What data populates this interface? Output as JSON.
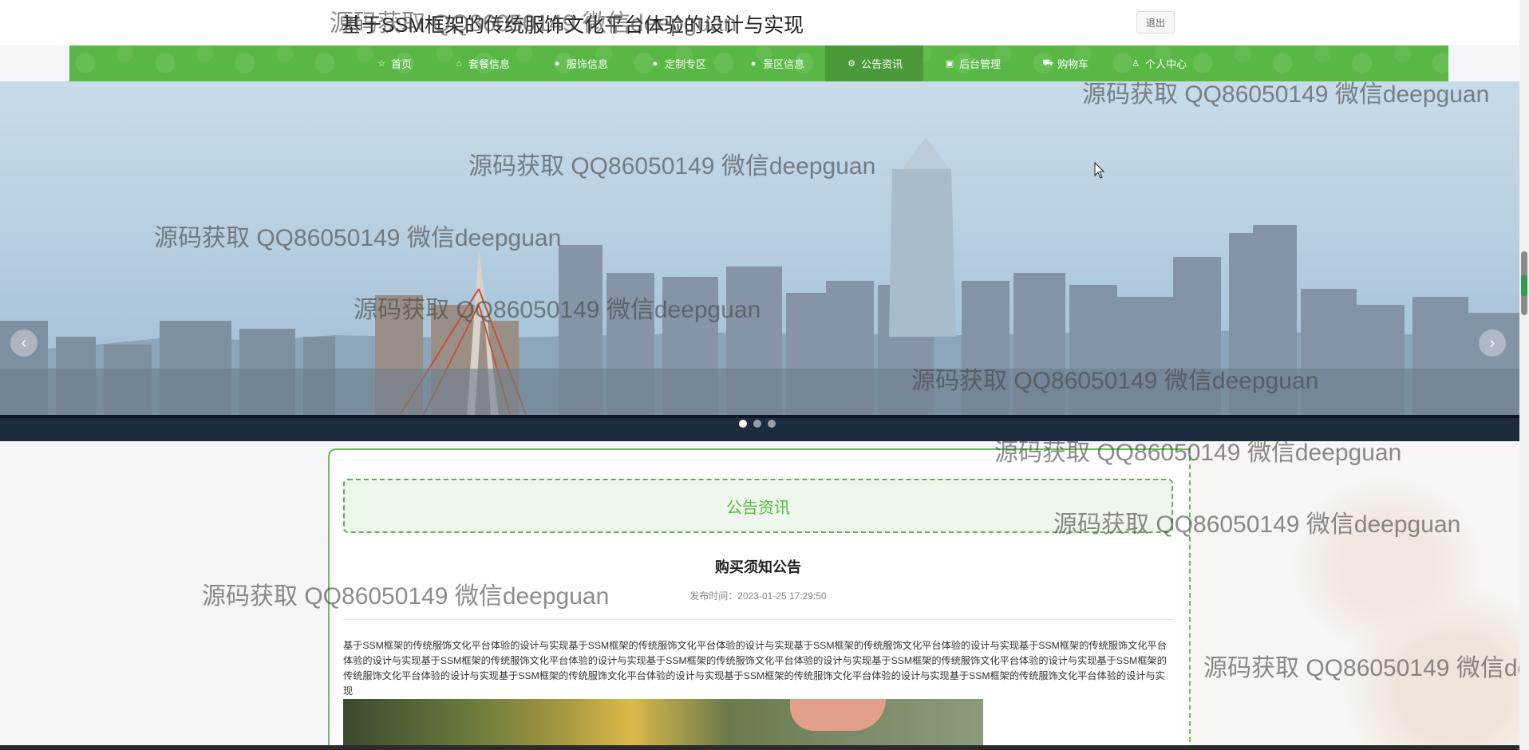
{
  "header": {
    "site_title": "基于SSM框架的传统服饰文化平台体验的设计与实现",
    "logout_label": "退出"
  },
  "nav": {
    "items": [
      {
        "label": "首页",
        "icon": "star-icon",
        "glyph": "☆"
      },
      {
        "label": "套餐信息",
        "icon": "bag-icon",
        "glyph": "⌂"
      },
      {
        "label": "服饰信息",
        "icon": "info-icon",
        "glyph": "●"
      },
      {
        "label": "定制专区",
        "icon": "help-icon",
        "glyph": "●"
      },
      {
        "label": "景区信息",
        "icon": "info-icon",
        "glyph": "●"
      },
      {
        "label": "公告资讯",
        "icon": "gear-icon",
        "glyph": "⚙"
      },
      {
        "label": "后台管理",
        "icon": "gift-icon",
        "glyph": "▣"
      },
      {
        "label": "购物车",
        "icon": "cart-icon",
        "glyph": "⛟"
      },
      {
        "label": "个人中心",
        "icon": "user-icon",
        "glyph": "♙"
      }
    ],
    "active_index": 5
  },
  "banner": {
    "prev_glyph": "‹",
    "next_glyph": "›",
    "slide_count": 3,
    "active_slide": 0
  },
  "section": {
    "title": "公告资讯"
  },
  "article": {
    "title": "购买须知公告",
    "published": "发布时间：2023-01-25 17:29:50",
    "body": "基于SSM框架的传统服饰文化平台体验的设计与实现基于SSM框架的传统服饰文化平台体验的设计与实现基于SSM框架的传统服饰文化平台体验的设计与实现基于SSM框架的传统服饰文化平台体验的设计与实现基于SSM框架的传统服饰文化平台体验的设计与实现基于SSM框架的传统服饰文化平台体验的设计与实现基于SSM框架的传统服饰文化平台体验的设计与实现基于SSM框架的传统服饰文化平台体验的设计与实现基于SSM框架的传统服饰文化平台体验的设计与实现基于SSM框架的传统服饰文化平台体验的设计与实现基于SSM框架的传统服饰文化平台体验的设计与实现"
  },
  "watermark": {
    "text": "源码获取 QQ86050149 微信deepguan"
  },
  "colors": {
    "brand_green": "#59b845",
    "active_green": "#4a9a3a"
  }
}
